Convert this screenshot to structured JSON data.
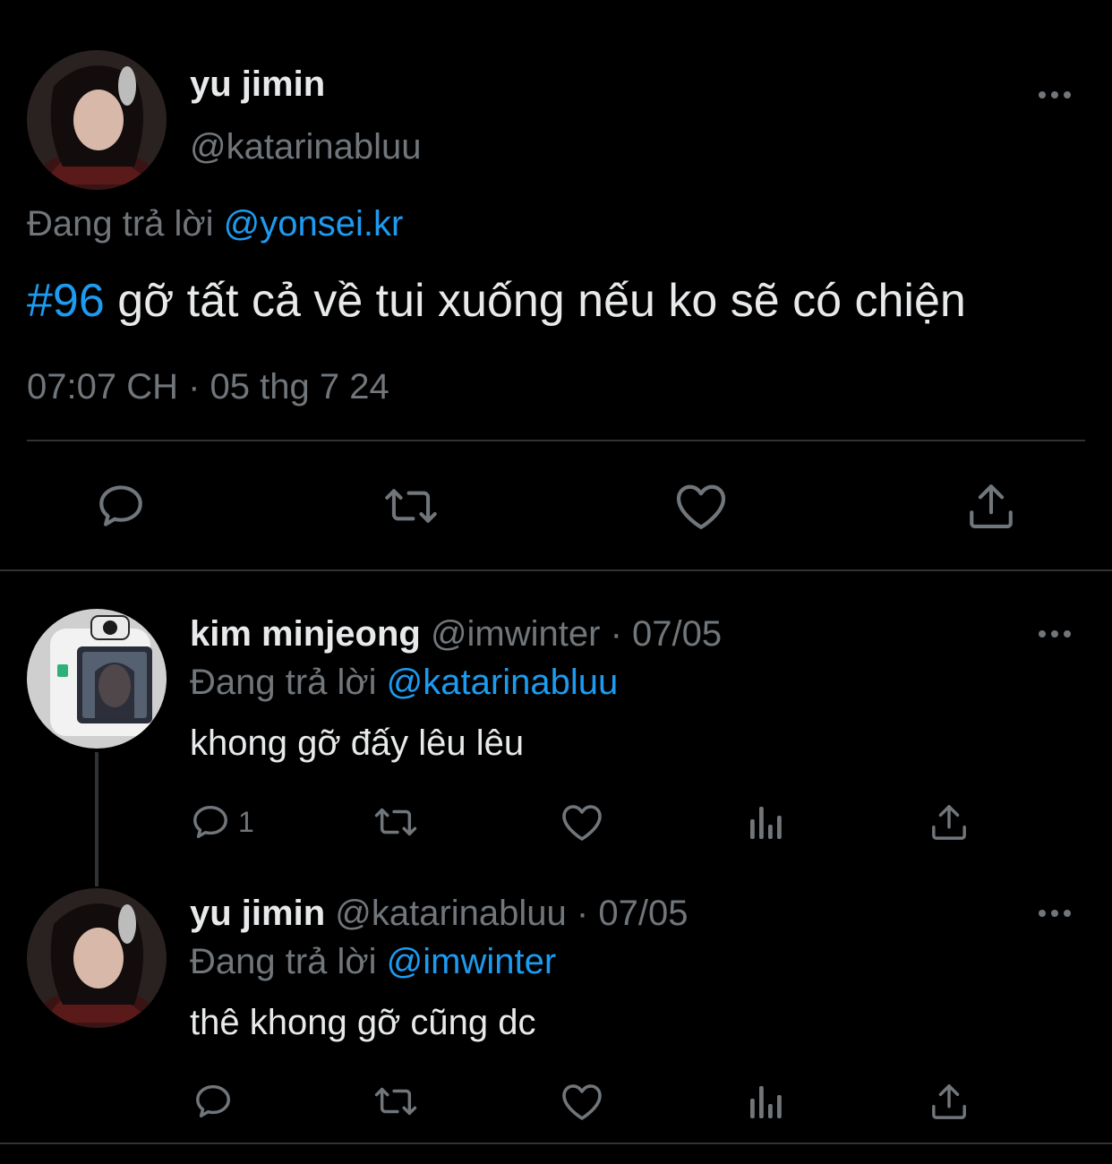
{
  "main_tweet": {
    "display_name": "yu jimin",
    "handle": "@katarinabluu",
    "replying_prefix": "Đang trả lời",
    "replying_to": "@yonsei.kr",
    "hashtag": "#96",
    "text": "gỡ tất cả về tui xuống nếu ko sẽ có chiện",
    "timestamp": "07:07 CH · 05 thg 7 24",
    "avatar_icon": "profile-photo"
  },
  "replies": [
    {
      "display_name": "kim minjeong",
      "handle_date": "@imwinter · 07/05",
      "replying_prefix": "Đang trả lời",
      "replying_to": "@katarinabluu",
      "text": "khong gỡ đấy lêu lêu",
      "reply_count": "1",
      "avatar_icon": "camera-photo"
    },
    {
      "display_name": "yu jimin",
      "handle_date": "@katarinabluu · 07/05",
      "replying_prefix": "Đang trả lời",
      "replying_to": "@imwinter",
      "text": "thê khong gỡ cũng dc",
      "reply_count": "",
      "avatar_icon": "profile-photo"
    }
  ],
  "colors": {
    "background": "#000000",
    "text": "#e7e9ea",
    "muted": "#71767b",
    "link": "#1d9bf0",
    "divider": "#2f3336"
  }
}
